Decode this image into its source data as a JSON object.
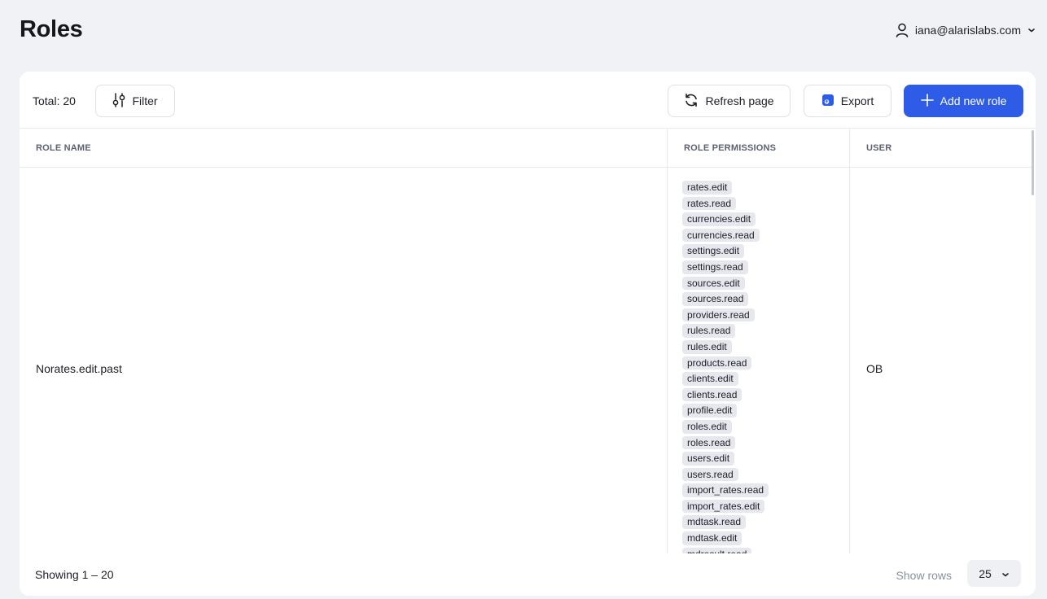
{
  "page": {
    "title": "Roles"
  },
  "user": {
    "email": "iana@alarislabs.com",
    "icon": "user-icon"
  },
  "toolbar": {
    "total": "Total: 20",
    "filter_label": "Filter",
    "refresh_label": "Refresh page",
    "export_label": "Export",
    "add_label": "Add new role",
    "accent_color": "#2e5ce6"
  },
  "table": {
    "columns": [
      "ROLE NAME",
      "ROLE PERMISSIONS",
      "USER"
    ],
    "rows": [
      {
        "role_name": "Norates.edit.past",
        "user": "OB",
        "permissions": [
          "rates.edit",
          "rates.read",
          "currencies.edit",
          "currencies.read",
          "settings.edit",
          "settings.read",
          "sources.edit",
          "sources.read",
          "providers.read",
          "rules.read",
          "rules.edit",
          "products.read",
          "clients.edit",
          "clients.read",
          "profile.edit",
          "roles.edit",
          "roles.read",
          "users.edit",
          "users.read",
          "import_rates.read",
          "import_rates.edit",
          "mdtask.read",
          "mdtask.edit",
          "mdresult.read"
        ]
      }
    ]
  },
  "footer": {
    "showing": "Showing 1 – 20",
    "rows_label": "Show rows",
    "rows_value": "25"
  }
}
